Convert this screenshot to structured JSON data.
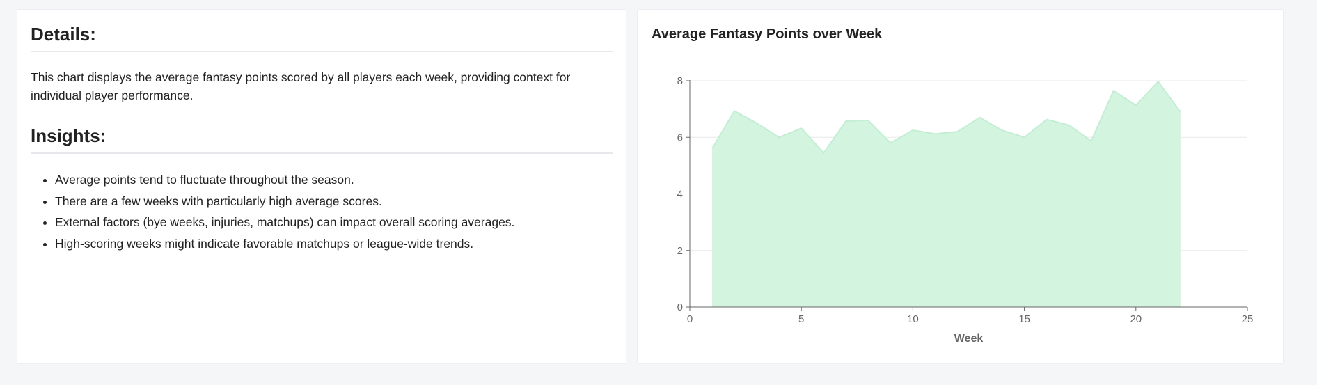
{
  "details": {
    "heading": "Details:",
    "text": "This chart displays the average fantasy points scored by all players each week, providing context for individual player performance."
  },
  "insights": {
    "heading": "Insights:",
    "items": [
      "Average points tend to fluctuate throughout the season.",
      "There are a few weeks with particularly high average scores.",
      "External factors (bye weeks, injuries, matchups) can impact overall scoring averages.",
      "High-scoring weeks might indicate favorable matchups or league-wide trends."
    ]
  },
  "colors": {
    "area_fill": "#d3f5e0",
    "area_stroke": "#c3eed3"
  },
  "chart_data": {
    "type": "area",
    "title": "Average Fantasy Points over Week",
    "xlabel": "Week",
    "ylabel": "",
    "xlim": [
      0,
      25
    ],
    "ylim": [
      0,
      8
    ],
    "xticks": [
      0,
      5,
      10,
      15,
      20,
      25
    ],
    "yticks": [
      0,
      2,
      4,
      6,
      8
    ],
    "grid": "horizontal",
    "x": [
      1,
      2,
      3,
      4,
      5,
      6,
      7,
      8,
      9,
      10,
      11,
      12,
      13,
      14,
      15,
      16,
      17,
      18,
      19,
      20,
      21,
      22
    ],
    "values": [
      5.6,
      6.93,
      6.5,
      6.0,
      6.32,
      5.45,
      6.57,
      6.6,
      5.8,
      6.25,
      6.12,
      6.2,
      6.7,
      6.25,
      6.0,
      6.63,
      6.43,
      5.87,
      7.65,
      7.13,
      7.97,
      6.9
    ]
  }
}
